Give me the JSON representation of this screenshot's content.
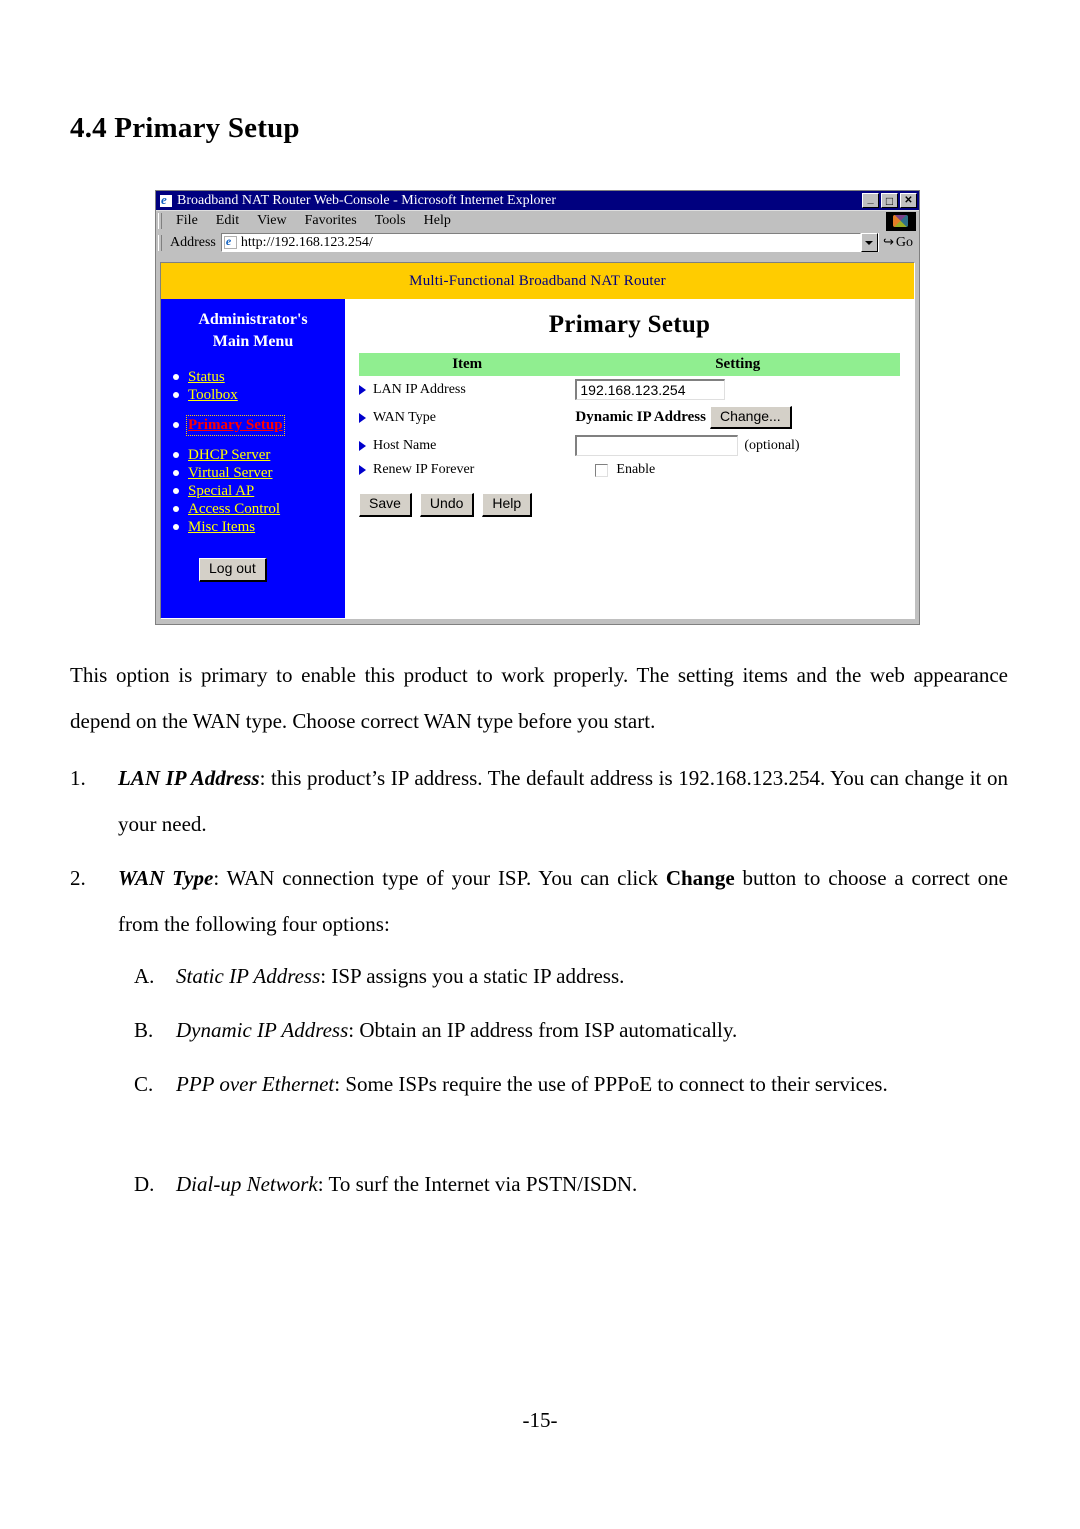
{
  "document": {
    "heading": "4.4 Primary Setup",
    "page_number": "-15-",
    "intro_paragraph": "This option is primary to enable this product to work properly. The setting items and the web appearance depend on the WAN type. Choose correct WAN type before you start.",
    "list": [
      {
        "marker": "1.",
        "term": "LAN IP Address",
        "body": ": this product’s IP address. The default address is 192.168.123.254. You can change it on your need."
      },
      {
        "marker": "2.",
        "term": "WAN Type",
        "body_before_bold": ": WAN connection type of your ISP. You can click ",
        "bold_word": "Change",
        "body_after_bold": " button to choose a correct one from the following four options:"
      }
    ],
    "sublist": [
      {
        "marker": "A.",
        "term": "Static IP Address",
        "body": ": ISP assigns you a static IP address."
      },
      {
        "marker": "B.",
        "term": "Dynamic IP Address",
        "body": ": Obtain an IP address from ISP automatically."
      },
      {
        "marker": "C.",
        "term": "PPP over Ethernet",
        "body": ": Some ISPs require the use of PPPoE to connect to their services."
      },
      {
        "marker": "D.",
        "term": "Dial-up Network",
        "body": ": To surf the Internet via PSTN/ISDN."
      }
    ]
  },
  "browser": {
    "title": "Broadband NAT Router Web-Console - Microsoft Internet Explorer",
    "window_controls": {
      "minimize": "_",
      "maximize": "□",
      "close": "✕"
    },
    "menu": [
      "File",
      "Edit",
      "View",
      "Favorites",
      "Tools",
      "Help"
    ],
    "address_label": "Address",
    "address_value": "http://192.168.123.254/",
    "go_label": "Go",
    "go_arrow": "↪"
  },
  "router_page": {
    "banner": "Multi-Functional Broadband NAT Router",
    "sidebar": {
      "title_line1": "Administrator's",
      "title_line2": "Main Menu",
      "items": [
        {
          "label": "Status",
          "active": false,
          "gap_before": false
        },
        {
          "label": "Toolbox",
          "active": false,
          "gap_before": false
        },
        {
          "label": "Primary Setup",
          "active": true,
          "gap_before": true
        },
        {
          "label": "DHCP Server",
          "active": false,
          "gap_before": true
        },
        {
          "label": "Virtual Server",
          "active": false,
          "gap_before": false
        },
        {
          "label": "Special AP",
          "active": false,
          "gap_before": false
        },
        {
          "label": "Access Control",
          "active": false,
          "gap_before": false
        },
        {
          "label": "Misc Items",
          "active": false,
          "gap_before": false
        }
      ],
      "logout_label": "Log out"
    },
    "content": {
      "title": "Primary Setup",
      "table_headers": {
        "item": "Item",
        "setting": "Setting"
      },
      "rows": [
        {
          "item": "LAN IP Address",
          "value": "192.168.123.254"
        },
        {
          "item": "WAN Type",
          "value": "Dynamic IP Address",
          "button": "Change..."
        },
        {
          "item": "Host Name",
          "value": "",
          "note": "(optional)"
        },
        {
          "item": "Renew IP Forever",
          "checkbox_label": "Enable",
          "checked": false
        }
      ],
      "buttons": [
        "Save",
        "Undo",
        "Help"
      ]
    },
    "colors": {
      "banner_bg": "#ffcc00",
      "sidebar_bg": "#0000ff",
      "link": "#ffff00",
      "active_link": "#ff0000",
      "table_header_bg": "#90ee90",
      "title_bar_bg": "#00007f"
    }
  }
}
